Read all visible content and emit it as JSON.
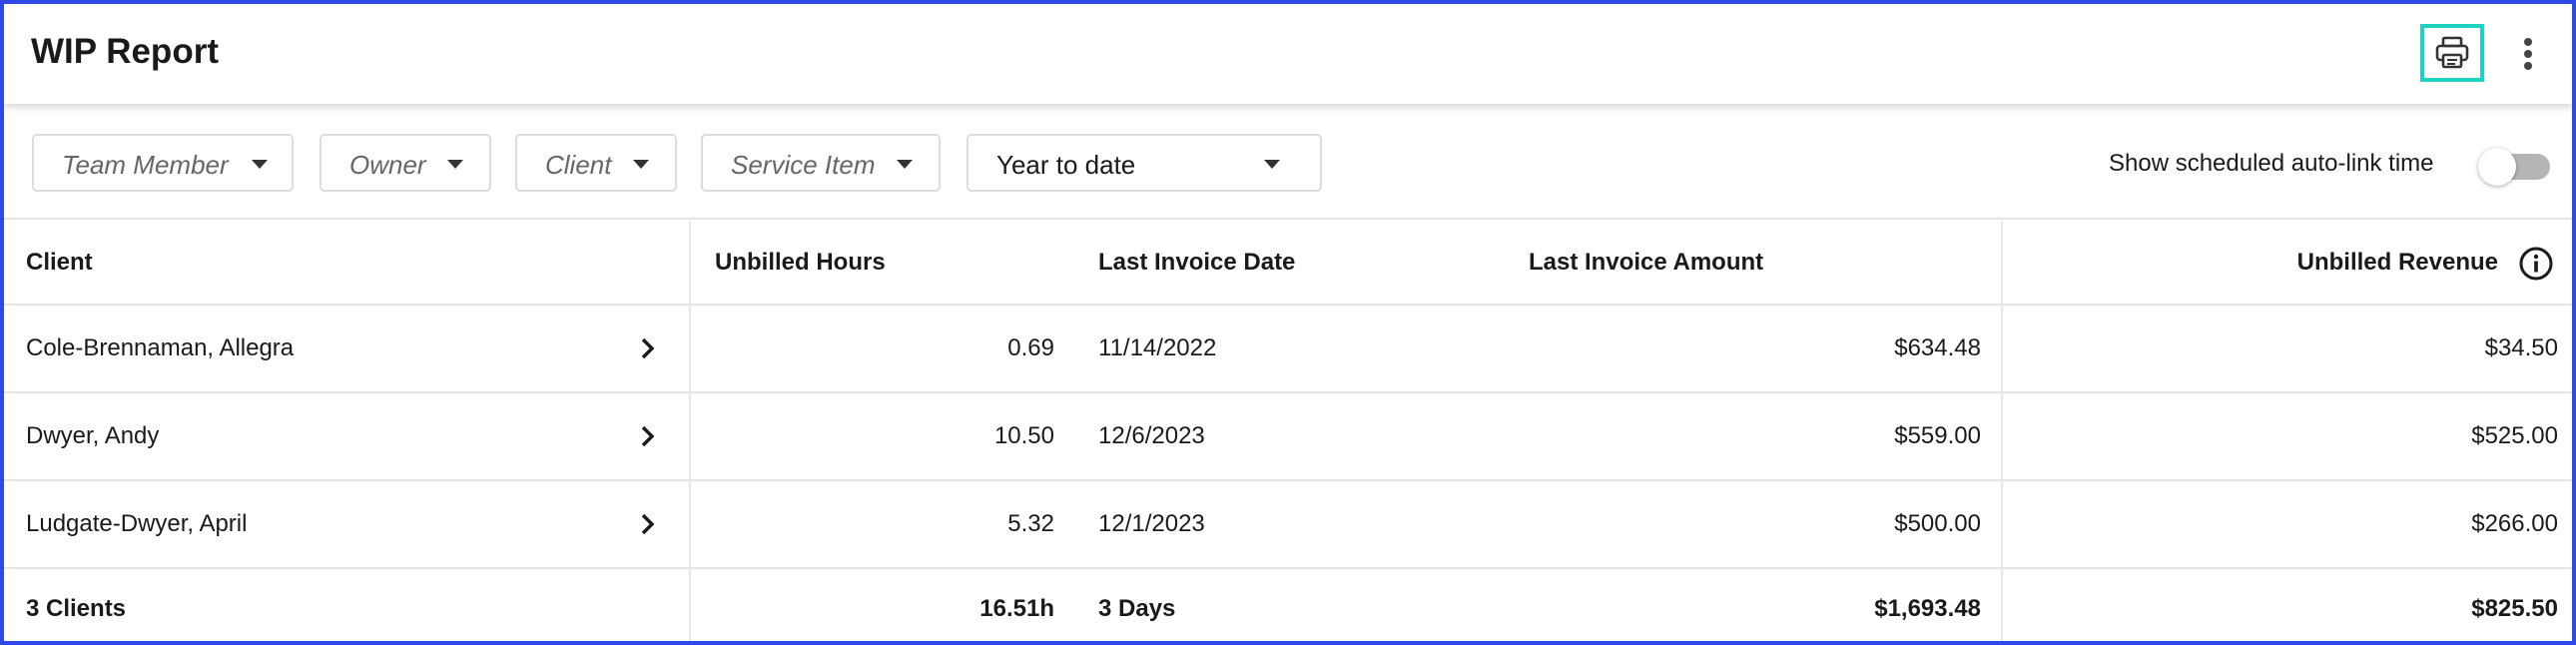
{
  "header": {
    "title": "WIP Report",
    "print_icon": "printer-icon",
    "more_icon": "more-vertical-icon"
  },
  "filters": {
    "team_member": "Team Member",
    "owner": "Owner",
    "client": "Client",
    "service_item": "Service Item",
    "period": "Year to date",
    "toggle_label": "Show scheduled auto-link time",
    "toggle_on": false
  },
  "table": {
    "columns": {
      "client": "Client",
      "unbilled_hours": "Unbilled Hours",
      "last_invoice_date": "Last Invoice Date",
      "last_invoice_amount": "Last Invoice Amount",
      "unbilled_revenue": "Unbilled Revenue"
    },
    "rows": [
      {
        "client": "Cole-Brennaman, Allegra",
        "unbilled_hours": "0.69",
        "last_invoice_date": "11/14/2022",
        "last_invoice_amount": "$634.48",
        "unbilled_revenue": "$34.50"
      },
      {
        "client": "Dwyer, Andy",
        "unbilled_hours": "10.50",
        "last_invoice_date": "12/6/2023",
        "last_invoice_amount": "$559.00",
        "unbilled_revenue": "$525.00"
      },
      {
        "client": "Ludgate-Dwyer, April",
        "unbilled_hours": "5.32",
        "last_invoice_date": "12/1/2023",
        "last_invoice_amount": "$500.00",
        "unbilled_revenue": "$266.00"
      }
    ],
    "totals": {
      "client": "3 Clients",
      "unbilled_hours": "16.51h",
      "last_invoice_date": "3 Days",
      "last_invoice_amount": "$1,693.48",
      "unbilled_revenue": "$825.50"
    }
  },
  "colors": {
    "frame_border": "#2e49e6",
    "print_highlight": "#1ed4c0",
    "toggle_track": "#b5b5b5"
  }
}
